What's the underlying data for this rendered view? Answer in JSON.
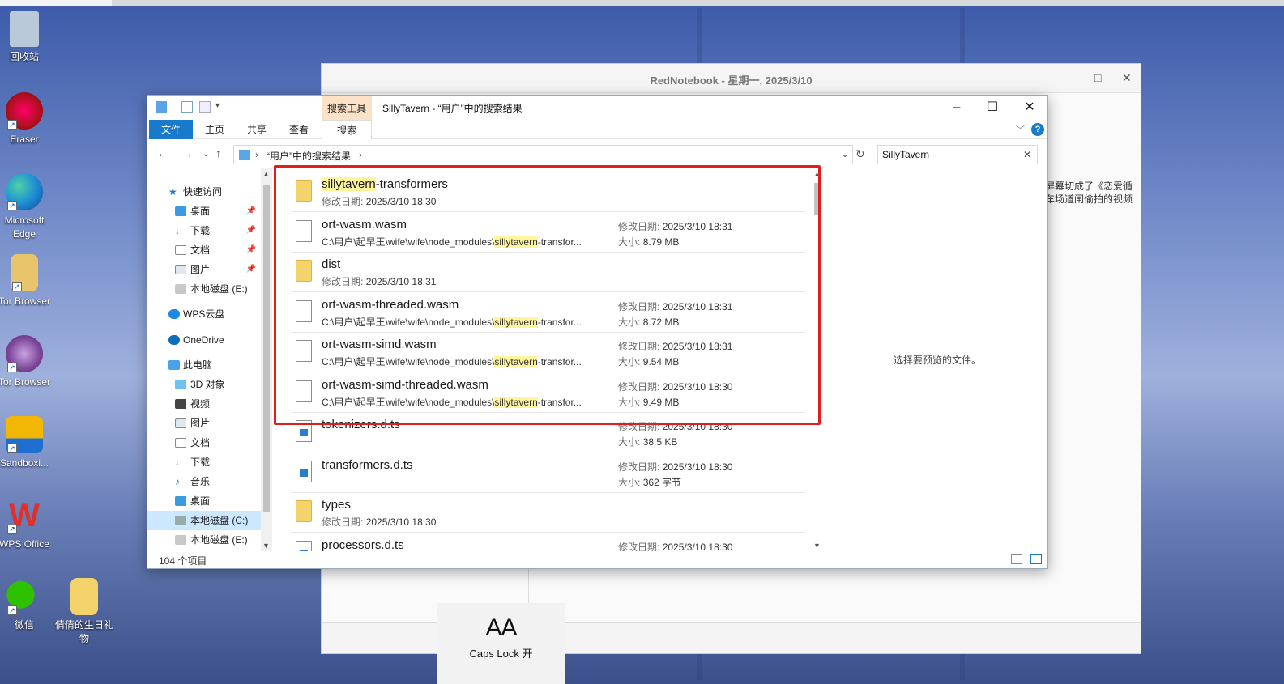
{
  "desktop": {
    "icons": [
      {
        "label": "回收站",
        "icon": "recycle-bin-icon",
        "color": "#9fb3c8"
      },
      {
        "label": "Eraser",
        "icon": "eraser-icon",
        "color": "#c0202a"
      },
      {
        "label": "Microsoft Edge",
        "icon": "edge-icon",
        "color": "#1f8fd6"
      },
      {
        "label": "Tor Browser",
        "icon": "tor-folder-icon",
        "color": "#e8c56a"
      },
      {
        "label": "Tor Browser",
        "icon": "tor-browser-icon",
        "color": "#7d4698"
      },
      {
        "label": "Sandboxi...",
        "icon": "sandboxie-icon",
        "color": "#f2b705"
      },
      {
        "label": "WPS Office",
        "icon": "wps-office-icon",
        "color": "#e0302a"
      },
      {
        "label": "微信",
        "icon": "wechat-icon",
        "color": "#2dc100"
      },
      {
        "label": "倩倩的生日礼物",
        "icon": "folder-icon",
        "color": "#f3d36a"
      }
    ]
  },
  "rednotebook": {
    "title": "RedNotebook - 星期一, 2025/3/10",
    "text_line1": "屏幕切成了《恋爱循",
    "text_line2": "车场道闸偷拍的视频"
  },
  "explorer": {
    "context_tab": "搜索工具",
    "title": "SillyTavern - “用户”中的搜索结果",
    "tabs": {
      "file": "文件",
      "home": "主页",
      "share": "共享",
      "view": "查看",
      "search": "搜索"
    },
    "address": {
      "path": "“用户”中的搜索结果"
    },
    "search": {
      "value": "SillyTavern"
    },
    "nav": {
      "quick_access": "快速访问",
      "desktop": "桌面",
      "downloads": "下载",
      "documents": "文档",
      "pictures": "图片",
      "disk_e": "本地磁盘 (E:)",
      "wps_cloud": "WPS云盘",
      "onedrive": "OneDrive",
      "this_pc": "此电脑",
      "objects3d": "3D 对象",
      "videos": "视频",
      "pictures2": "图片",
      "documents2": "文档",
      "downloads2": "下载",
      "music": "音乐",
      "desktop2": "桌面",
      "disk_c": "本地磁盘 (C:)",
      "disk_e2": "本地磁盘 (E:)"
    },
    "labels": {
      "modified": "修改日期:",
      "size": "大小:"
    },
    "files": [
      {
        "name_hl": "sillytavern",
        "name_rest": "-transformers",
        "kind": "folder",
        "date": "2025/3/10 18:30"
      },
      {
        "name": "ort-wasm.wasm",
        "kind": "file",
        "path_pre": "C:\\用户\\起早王\\wife\\wife\\node_modules\\",
        "path_hl": "sillytavern",
        "path_post": "-transfor...",
        "date": "2025/3/10 18:31",
        "size": "8.79 MB"
      },
      {
        "name": "dist",
        "kind": "folder",
        "date": "2025/3/10 18:31"
      },
      {
        "name": "ort-wasm-threaded.wasm",
        "kind": "file",
        "path_pre": "C:\\用户\\起早王\\wife\\wife\\node_modules\\",
        "path_hl": "sillytavern",
        "path_post": "-transfor...",
        "date": "2025/3/10 18:31",
        "size": "8.72 MB"
      },
      {
        "name": "ort-wasm-simd.wasm",
        "kind": "file",
        "path_pre": "C:\\用户\\起早王\\wife\\wife\\node_modules\\",
        "path_hl": "sillytavern",
        "path_post": "-transfor...",
        "date": "2025/3/10 18:31",
        "size": "9.54 MB"
      },
      {
        "name": "ort-wasm-simd-threaded.wasm",
        "kind": "file",
        "path_pre": "C:\\用户\\起早王\\wife\\wife\\node_modules\\",
        "path_hl": "sillytavern",
        "path_post": "-transfor...",
        "date": "2025/3/10 18:30",
        "size": "9.49 MB"
      },
      {
        "name": "tokenizers.d.ts",
        "kind": "ts",
        "date": "2025/3/10 18:30",
        "size": "38.5 KB"
      },
      {
        "name": "transformers.d.ts",
        "kind": "ts",
        "date": "2025/3/10 18:30",
        "size": "362 字节"
      },
      {
        "name": "types",
        "kind": "folder",
        "date": "2025/3/10 18:30"
      },
      {
        "name": "processors.d.ts",
        "kind": "ts",
        "date": "2025/3/10 18:30"
      }
    ],
    "preview_text": "选择要预览的文件。",
    "status_count": "104 个项目"
  },
  "capslock": {
    "glyph": "AA",
    "label": "Caps Lock 开"
  },
  "colors": {
    "accent": "#1979ca",
    "highlight": "#fff59d",
    "annotation": "#e01e1e",
    "context_tab": "#fbe1c5"
  }
}
